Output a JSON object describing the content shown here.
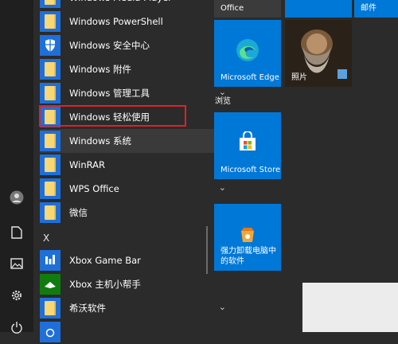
{
  "apps": [
    {
      "label": "Windows PowerShell",
      "icon": "folder-icon",
      "chevron": true
    },
    {
      "label": "Windows 安全中心",
      "icon": "shield-icon",
      "chevron": false
    },
    {
      "label": "Windows 附件",
      "icon": "folder-icon",
      "chevron": true
    },
    {
      "label": "Windows 管理工具",
      "icon": "folder-icon",
      "chevron": true
    },
    {
      "label": "Windows 轻松使用",
      "icon": "folder-icon",
      "chevron": true
    },
    {
      "label": "Windows 系统",
      "icon": "folder-icon",
      "chevron": true
    },
    {
      "label": "WinRAR",
      "icon": "folder-icon",
      "chevron": true
    },
    {
      "label": "WPS Office",
      "icon": "folder-icon",
      "chevron": true
    },
    {
      "label": "微信",
      "icon": "folder-icon",
      "chevron": true
    },
    {
      "label": "Xbox Game Bar",
      "icon": "xbox-game-bar-icon",
      "chevron": false
    },
    {
      "label": "Xbox 主机小帮手",
      "icon": "xbox-console-icon",
      "chevron": false
    },
    {
      "label": "希沃软件",
      "icon": "folder-icon",
      "chevron": true
    }
  ],
  "section_letter": "X",
  "chevron_glyph": "⌄",
  "tiles": {
    "office_label": "Office",
    "mail_label": "邮件",
    "edge_label": "Microsoft Edge",
    "photos_label": "照片",
    "browse_group_label": "浏览",
    "store_label": "Microsoft Store",
    "uninstall_label": "强力卸载电脑中的软件"
  },
  "colors": {
    "accent": "#0078d7",
    "start_bg": "#2b2b2b",
    "rail_bg": "#1f1f1f",
    "highlight_box": "#e0202a"
  }
}
